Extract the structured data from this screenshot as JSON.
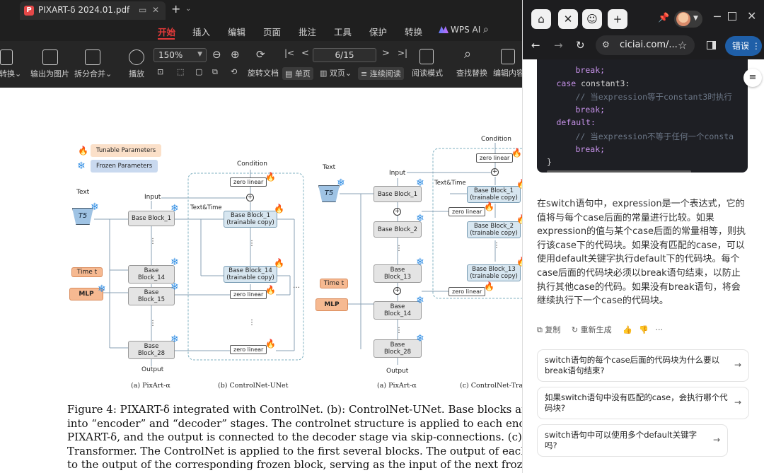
{
  "pdf": {
    "tab_title": "PIXART-δ 2024.01.pdf",
    "menus": [
      "开始",
      "插入",
      "编辑",
      "页面",
      "批注",
      "工具",
      "保护",
      "转换"
    ],
    "wps_ai": "WPS AI",
    "toolbar": {
      "convert": "转换",
      "export_image": "输出为图片",
      "split_merge": "拆分合并",
      "play": "播放",
      "zoom": "150%",
      "page": "6/15",
      "rotate": "旋转文档",
      "single_page": "单页",
      "double_page": "双页",
      "continuous": "连续阅读",
      "read_mode": "阅读模式",
      "find_replace": "查找替换",
      "edit_content": "编辑内容"
    },
    "figure": {
      "legend_tunable": "Tunable Parameters",
      "legend_frozen": "Frozen Parameters",
      "text": "Text",
      "t5": "T5",
      "input": "Input",
      "condition": "Condition",
      "zero_linear": "zero linear",
      "text_time": "Text&Time",
      "base_block_1": "Base Block_1",
      "base_block_2": "Base Block_2",
      "base": "Base",
      "block_13": "Block_13",
      "block_14": "Block_14",
      "block_15": "Block_15",
      "block_28": "Block_28",
      "ctrl_block_1": "Base Block_1",
      "ctrl_block_2": "Base Block_2",
      "ctrl_block_13": "Base Block_13",
      "ctrl_block_14": "Base Block_14",
      "trainable": "(trainable copy)",
      "time": "Time t",
      "mlp": "MLP",
      "output": "Output",
      "sub_a": "(a) PixArt-α",
      "sub_b": "(b) ControlNet-UNet",
      "sub_a2": "(a) PixArt-α",
      "sub_c": "(c) ControlNet-Transf"
    },
    "caption": [
      "Figure 4: PIXART-δ integrated with ControlNet. (b): ControlNet-UNet. Base blocks are categ",
      "into “encoder” and “decoder” stages. The controlnet structure is applied to each encoder le",
      "PIXART-δ, and the output is connected to the decoder stage via skip-connections. (c): Contro",
      "Transformer. The ControlNet is applied to the first several blocks. The output of each block is a",
      "to the output of the corresponding frozen block, serving as the input of the next frozen block."
    ]
  },
  "browser": {
    "url": "ciciai.com/...",
    "error_button": "错误",
    "code_lines": [
      {
        "indent": 4,
        "parts": [
          {
            "t": "break;",
            "c": "kw"
          }
        ]
      },
      {
        "indent": 2,
        "parts": [
          {
            "t": "case ",
            "c": "kw"
          },
          {
            "t": "constant3:",
            "c": ""
          }
        ]
      },
      {
        "indent": 4,
        "parts": [
          {
            "t": "// 当expression等于constant3时执行",
            "c": "cm"
          }
        ]
      },
      {
        "indent": 4,
        "parts": [
          {
            "t": "break;",
            "c": "kw"
          }
        ]
      },
      {
        "indent": 2,
        "parts": [
          {
            "t": "default:",
            "c": "kw"
          }
        ]
      },
      {
        "indent": 4,
        "parts": [
          {
            "t": "// 当expression不等于任何一个consta",
            "c": "cm"
          }
        ]
      },
      {
        "indent": 4,
        "parts": [
          {
            "t": "break;",
            "c": "kw"
          }
        ]
      },
      {
        "indent": 1,
        "parts": [
          {
            "t": "}",
            "c": ""
          }
        ]
      }
    ],
    "answer": "在switch语句中，expression是一个表达式，它的值将与每个case后面的常量进行比较。如果expression的值与某个case后面的常量相等，则执行该case下的代码块。如果没有匹配的case，可以使用default关键字执行default下的代码块。每个case后面的代码块必须以break语句结束，以防止执行其他case的代码。如果没有break语句，将会继续执行下一个case的代码块。",
    "actions": {
      "copy": "复制",
      "regenerate": "重新生成"
    },
    "suggestions": [
      "switch语句的每个case后面的代码块为什么要以break语句结束?",
      "如果switch语句中没有匹配的case，会执行哪个代码块?",
      "switch语句中可以使用多个default关键字吗?"
    ]
  }
}
